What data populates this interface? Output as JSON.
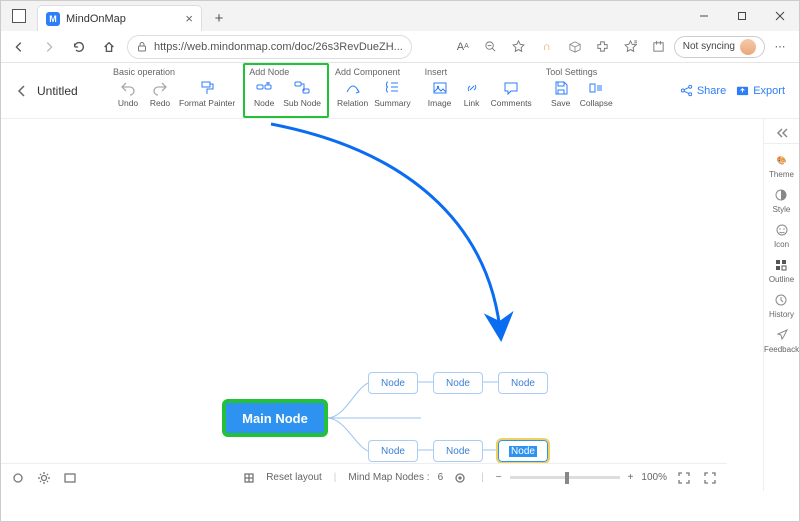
{
  "browser": {
    "tab_title": "MindOnMap",
    "url": "https://web.mindonmap.com/doc/26s3RevDueZH...",
    "sync_label": "Not syncing"
  },
  "app": {
    "doc_title": "Untitled",
    "share_label": "Share",
    "export_label": "Export",
    "groups": {
      "basic": {
        "label": "Basic operation",
        "undo": "Undo",
        "redo": "Redo",
        "format": "Format Painter"
      },
      "add_node": {
        "label": "Add Node",
        "node": "Node",
        "sub": "Sub Node"
      },
      "add_comp": {
        "label": "Add Component",
        "relation": "Relation",
        "summary": "Summary"
      },
      "insert": {
        "label": "Insert",
        "image": "Image",
        "link": "Link",
        "comments": "Comments"
      },
      "tool": {
        "label": "Tool Settings",
        "save": "Save",
        "collapse": "Collapse"
      }
    }
  },
  "right_panel": {
    "theme": "Theme",
    "style": "Style",
    "icon": "Icon",
    "outline": "Outline",
    "history": "History",
    "feedback": "Feedback"
  },
  "canvas": {
    "main": "Main Node",
    "nodes": [
      "Node",
      "Node",
      "Node",
      "Node",
      "Node",
      "Node"
    ]
  },
  "bottom": {
    "reset": "Reset layout",
    "nodes_label": "Mind Map Nodes :",
    "nodes_count": "6",
    "zoom": "100%"
  }
}
